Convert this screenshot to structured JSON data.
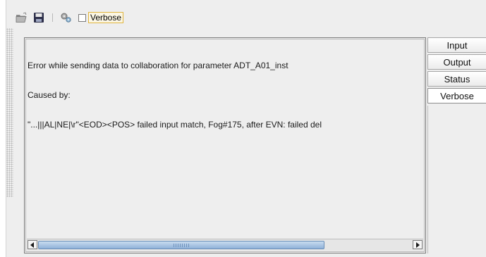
{
  "toolbar": {
    "open_icon": "folder-open-icon",
    "save_icon": "floppy-disk-icon",
    "settings_icon": "gears-icon",
    "verbose_checked": false,
    "verbose_label": "Verbose"
  },
  "log": {
    "lines": [
      "Error while sending data to collaboration for parameter ADT_A01_inst",
      "Caused by:",
      "\"...|||AL|NE|\\r\"<EOD><POS> failed input match, Fog#175, after EVN: failed del"
    ]
  },
  "tabs": [
    {
      "label": "Input"
    },
    {
      "label": "Output"
    },
    {
      "label": "Status"
    },
    {
      "label": "Verbose"
    }
  ],
  "scrollbar": {
    "left_icon": "arrow-left-icon",
    "right_icon": "arrow-right-icon"
  }
}
